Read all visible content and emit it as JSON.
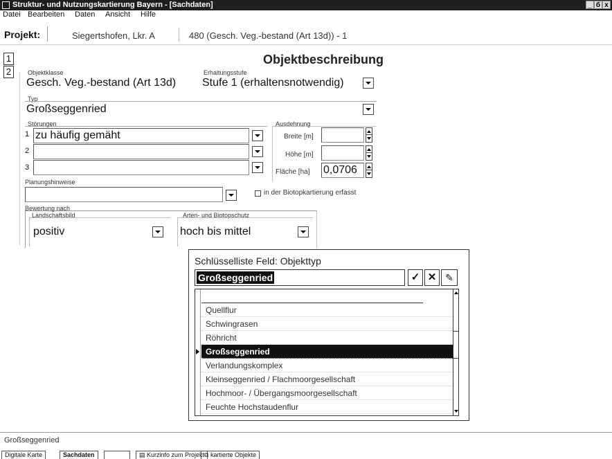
{
  "window": {
    "title": "Struktur- und Nutzungskartierung Bayern - [Sachdaten]",
    "controls": [
      "_",
      "б",
      "x"
    ]
  },
  "menu": [
    "Datei",
    "Bearbeiten",
    "Daten",
    "Ansicht",
    "Hilfe"
  ],
  "project": {
    "label": "Projekt:",
    "name": "Siegertshofen, Lkr. A",
    "info": "480 (Gesch. Veg.-bestand (Art 13d)) - 1"
  },
  "pages": [
    "1",
    "2"
  ],
  "heading": "Objektbeschreibung",
  "form": {
    "objektklasse_label": "Objektklasse",
    "objektklasse_value": "Gesch. Veg.-bestand (Art 13d)",
    "erhaltungsstufe_label": "Erhaltungsstufe",
    "erhaltungsstufe_value": "Stufe 1 (erhaltensnotwendig)",
    "typ_label": "Typ",
    "typ_value": "Großseggenried",
    "stoerungen_label": "Störungen",
    "stoerungen": [
      {
        "num": "1",
        "value": "zu häufig gemäht"
      },
      {
        "num": "2",
        "value": ""
      },
      {
        "num": "3",
        "value": ""
      }
    ],
    "ausdehnung_label": "Ausdehnung",
    "breite_label": "Breite [m]",
    "breite_value": "",
    "hoehe_label": "Höhe [m]",
    "hoehe_value": "",
    "flaeche_label": "Fläche [ha]",
    "flaeche_value": "0,0706",
    "planung_label": "Planungshinweise",
    "planung_value": "",
    "biotop_checkbox_label": "in der Biotopkartierung erfasst",
    "biotop_checked": false,
    "bewertung_label": "Bewertung nach",
    "landschaftsbild_label": "Landschaftsbild",
    "landschaftsbild_value": "positiv",
    "artenschutz_label": "Arten- und Biotopschutz",
    "artenschutz_value": "hoch bis mittel"
  },
  "lookup": {
    "title": "Schlüsselliste Feld:  Objekttyp",
    "search_value": "Großseggenried",
    "items": [
      "",
      "Quellflur",
      "Schwingrasen",
      "Röhricht",
      "Großseggenried",
      "Verlandungskomplex",
      "Kleinseggenried / Flachmoorgesellschaft",
      "Hochmoor- / Übergangsmoorgesellschaft",
      "Feuchte Hochstaudenflur"
    ],
    "selected_index": 4
  },
  "statusbar": "Großseggenried",
  "tabs": [
    "Digitale Karte",
    "Sachdaten",
    "",
    "Kurzinfo zum Projekt",
    "kartierte Objekte"
  ]
}
